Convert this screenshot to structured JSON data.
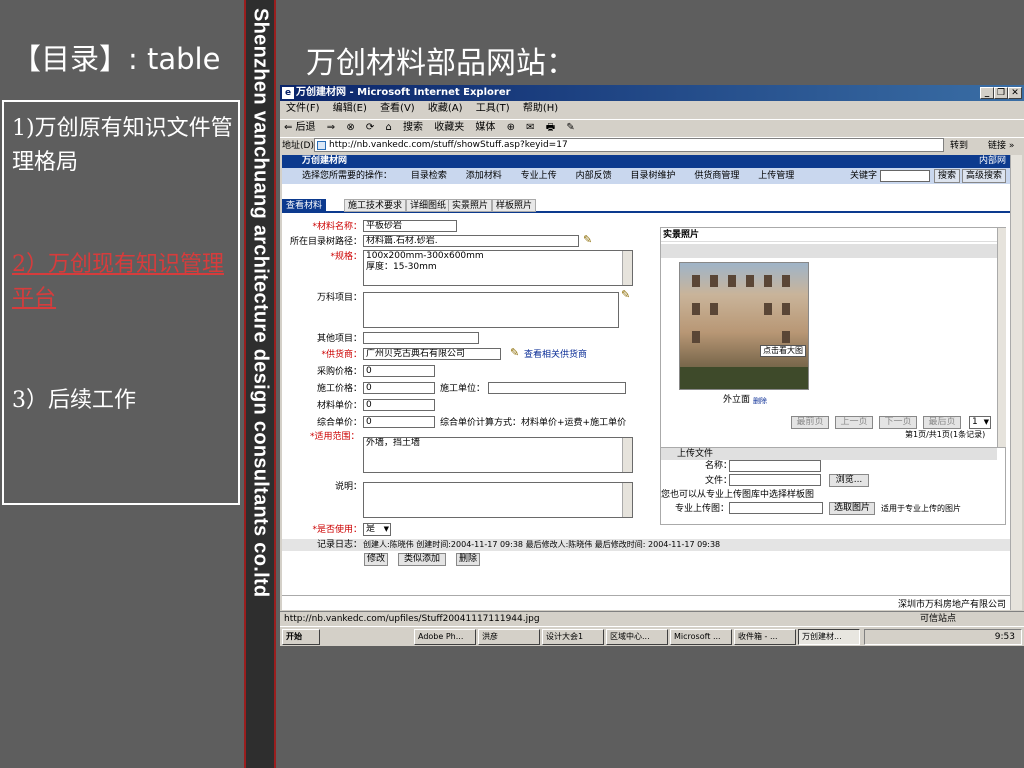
{
  "slide": {
    "left_title": "【目录】: table",
    "right_title": "万创材料部品网站：",
    "vertical_text": "Shenzhen vanchuang architecture design consultants co.ltd",
    "toc": [
      {
        "label": "1)万创原有知识文件管理格局"
      },
      {
        "label": "2）万创现有知识管理平台"
      },
      {
        "label": "3）后续工作"
      }
    ]
  },
  "browser": {
    "title": "万创建材网 - Microsoft Internet Explorer",
    "window_buttons": [
      "_",
      "❐",
      "✕"
    ],
    "menu": [
      "文件(F)",
      "编辑(E)",
      "查看(V)",
      "收藏(A)",
      "工具(T)",
      "帮助(H)"
    ],
    "toolbar": [
      "⇐ 后退",
      "⇒",
      "⊗",
      "⟳",
      "⌂",
      "搜索",
      "收藏夹",
      "媒体",
      "⊕",
      "✉",
      "🖶",
      "✎"
    ],
    "address_label": "地址(D)",
    "address": "http://nb.vankedc.com/stuff/showStuff.asp?keyid=17",
    "go_label": "转到",
    "links_label": "链接 »",
    "status_url": "http://nb.vankedc.com/upfiles/Stuff20041117111944.jpg",
    "zone": "可信站点"
  },
  "site": {
    "name": "万创建材网",
    "top_right": "内部网",
    "nav_prompt": "选择您所需要的操作：",
    "nav": [
      "目录检索",
      "添加材料",
      "专业上传",
      "内部反馈",
      "目录树维护",
      "供货商管理",
      "上传管理"
    ],
    "keyword_label": "关键字",
    "search_btn": "搜索",
    "adv_search_btn": "高级搜索"
  },
  "tabs": [
    "查看材料",
    "施工技术要求",
    "详细图纸",
    "实景照片",
    "样板照片"
  ],
  "form": {
    "name_label": "*材料名称：",
    "name": "平板砂岩",
    "path_label": "所在目录树路径：",
    "path": "材料篇.石材.砂岩.",
    "spec_label": "*规格：",
    "spec_line1": "100x200mm-300x600mm",
    "spec_line2": "厚度：15-30mm",
    "project_label": "万科项目：",
    "other_label": "其他项目：",
    "supplier_label": "*供货商：",
    "supplier": "广州贝克古典石有限公司",
    "supplier_link": "查看相关供货商",
    "purchase_label": "采购价格：",
    "purchase": "0",
    "construct_label": "施工价格：",
    "construct": "0",
    "unit_label": "施工单位：",
    "material_price_label": "材料单价：",
    "material_price": "0",
    "combined_label": "综合单价：",
    "combined": "0",
    "formula": "综合单价计算方式：材料单价+运费+施工单价",
    "scope_label": "*适用范围：",
    "scope": "外墙，挡土墙",
    "note_label": "说明：",
    "use_label": "*是否使用：",
    "use": "是",
    "log_label": "记录日志：",
    "log": "创建人:陈晓伟   创建时间:2004-11-17 09:38  最后修改人:陈晓伟  最后修改时间: 2004-11-17 09:38",
    "edit_btn": "修改",
    "add_similar_btn": "类似添加",
    "delete_btn": "删除",
    "footer": "深圳市万科房地产有限公司"
  },
  "photo": {
    "header": "实景照片",
    "zoom_label": "点击看大图",
    "caption": "外立面",
    "delete": "删除",
    "pager": [
      "最前页",
      "上一页",
      "下一页",
      "最后页"
    ],
    "page_select": "1",
    "page_info": "第1页/共1页(1条记录)"
  },
  "upload": {
    "header": "上传文件",
    "name_label": "名称：",
    "file_label": "文件：",
    "browse_btn": "浏览...",
    "hint": "您也可以从专业上传图库中选择样板图",
    "pro_label": "专业上传图：",
    "pick_btn": "选取图片",
    "pick_hint": "适用于专业上传的图片"
  },
  "taskbar": {
    "start": "开始",
    "tasks": [
      "Adobe Ph...",
      "洪彦",
      "设计大会1",
      "区域中心...",
      "Microsoft ...",
      "收件箱 - ...",
      "万创建材..."
    ],
    "clock": "9:53"
  }
}
